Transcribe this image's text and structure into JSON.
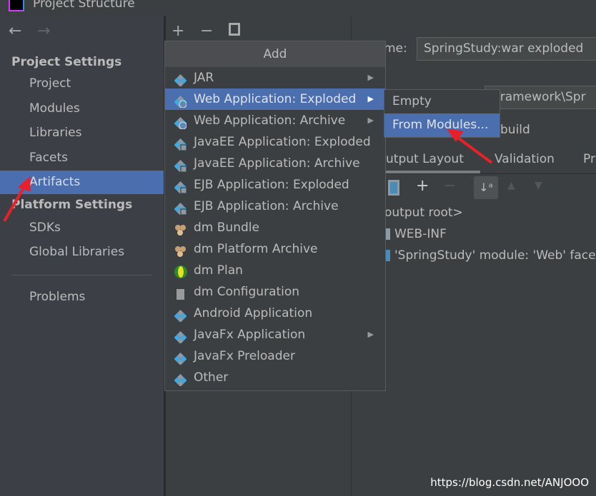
{
  "window": {
    "title": "Project Structure"
  },
  "sidebar": {
    "project_settings": "Project Settings",
    "items": [
      {
        "label": "Project"
      },
      {
        "label": "Modules"
      },
      {
        "label": "Libraries"
      },
      {
        "label": "Facets"
      },
      {
        "label": "Artifacts",
        "selected": true
      }
    ],
    "platform_settings": "Platform Settings",
    "platform_items": [
      {
        "label": "SDKs"
      },
      {
        "label": "Global Libraries"
      }
    ],
    "problems": "Problems"
  },
  "toolbar": {
    "add": "+",
    "remove": "−",
    "copy": "copy-icon"
  },
  "add_menu": {
    "title": "Add",
    "items": [
      {
        "label": "JAR",
        "icon": "artifact-icon",
        "submenu": true
      },
      {
        "label": "Web Application: Exploded",
        "icon": "web-artifact-icon",
        "submenu": true,
        "selected": true
      },
      {
        "label": "Web Application: Archive",
        "icon": "web-artifact-icon",
        "submenu": true
      },
      {
        "label": "JavaEE Application: Exploded",
        "icon": "javaee-icon"
      },
      {
        "label": "JavaEE Application: Archive",
        "icon": "javaee-icon"
      },
      {
        "label": "EJB Application: Exploded",
        "icon": "ejb-icon"
      },
      {
        "label": "EJB Application: Archive",
        "icon": "ejb-icon"
      },
      {
        "label": "dm Bundle",
        "icon": "bundle-icon"
      },
      {
        "label": "dm Platform Archive",
        "icon": "bundle-icon"
      },
      {
        "label": "dm Plan",
        "icon": "plan-icon"
      },
      {
        "label": "dm Configuration",
        "icon": "config-icon"
      },
      {
        "label": "Android Application",
        "icon": "artifact-icon"
      },
      {
        "label": "JavaFx Application",
        "icon": "artifact-icon",
        "submenu": true
      },
      {
        "label": "JavaFx Preloader",
        "icon": "artifact-icon"
      },
      {
        "label": "Other",
        "icon": "artifact-icon"
      }
    ]
  },
  "submenu": {
    "items": [
      {
        "label": "Empty"
      },
      {
        "label": "From Modules...",
        "selected": true
      }
    ]
  },
  "detail": {
    "name_label": "me:",
    "name_value": "SpringStudy:war exploded",
    "output_dir": "\\framework\\Spr",
    "build_label": "build",
    "tabs": [
      "utput Layout",
      "Validation",
      "Pr"
    ],
    "tree": [
      "output root>",
      "WEB-INF",
      "'SpringStudy' module: 'Web' face"
    ]
  },
  "watermark": "https://blog.csdn.net/ANJOOO",
  "colors": {
    "selection": "#4b6eaf",
    "annotation_arrow": "#e8202a"
  }
}
